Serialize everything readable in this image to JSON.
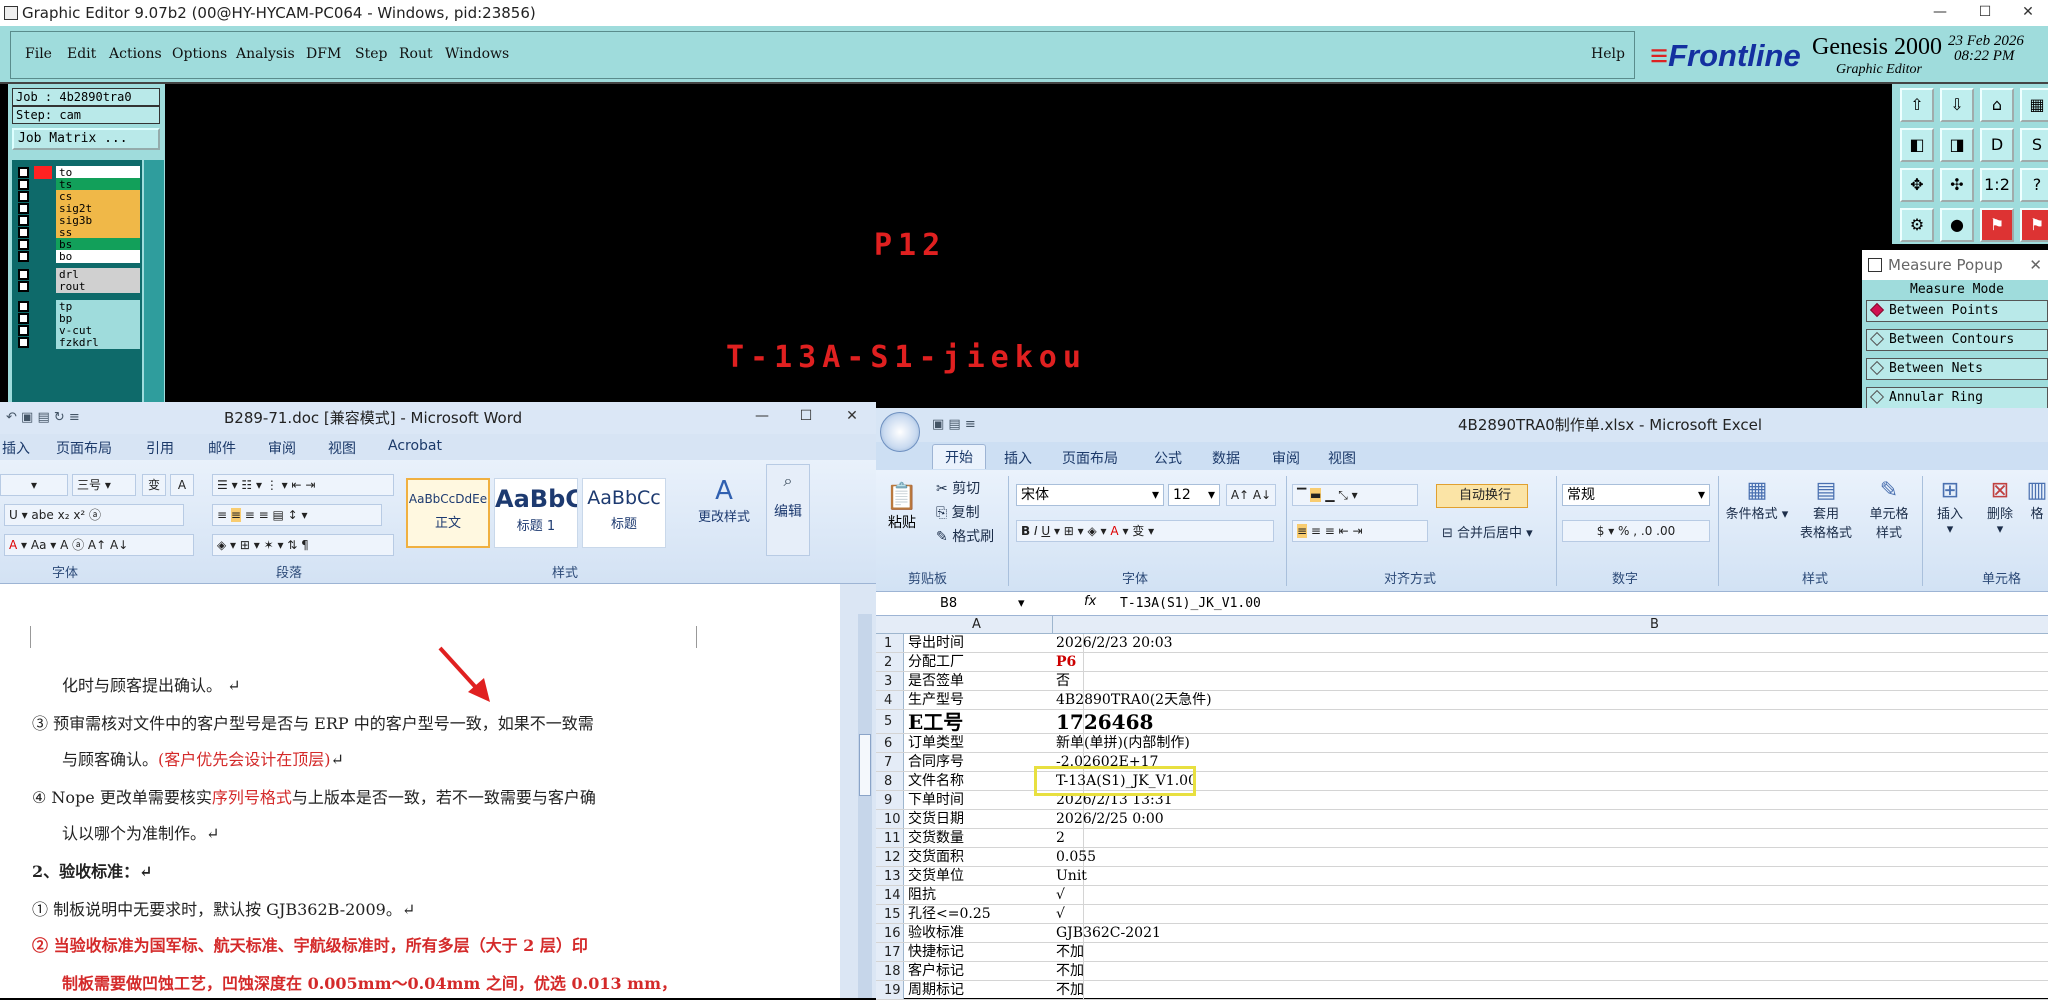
{
  "genesis": {
    "title": "Graphic Editor 9.07b2 (00@HY-HYCAM-PC064 - Windows, pid:23856)",
    "menus": [
      "File",
      "Edit",
      "Actions",
      "Options",
      "Analysis",
      "DFM",
      "Step",
      "Rout",
      "Windows"
    ],
    "help": "Help",
    "brand": "Frontline",
    "product": "Genesis 2000",
    "product_sub": "Graphic Editor",
    "date": "23 Feb 2026",
    "time": "08:22 PM",
    "job": "Job : 4b2890tra0",
    "step": "Step: cam",
    "job_matrix": "Job Matrix ...",
    "layers": [
      {
        "name": "to",
        "color": "#ffffff",
        "dot": true
      },
      {
        "name": "ts",
        "color": "#12a05a"
      },
      {
        "name": "cs",
        "color": "#f0b848"
      },
      {
        "name": "sig2t",
        "color": "#f0b848"
      },
      {
        "name": "sig3b",
        "color": "#f0b848"
      },
      {
        "name": "ss",
        "color": "#f0b848"
      },
      {
        "name": "bs",
        "color": "#12a05a"
      },
      {
        "name": "bo",
        "color": "#ffffff"
      },
      {
        "name": "drl",
        "color": "#d0d0d0"
      },
      {
        "name": "rout",
        "color": "#d0d0d0"
      },
      {
        "name": "tp",
        "color": "#9fdcdc"
      },
      {
        "name": "bp",
        "color": "#9fdcdc"
      },
      {
        "name": "v-cut",
        "color": "#9fdcdc"
      },
      {
        "name": "fzkdrl",
        "color": "#9fdcdc"
      }
    ],
    "canvas_texts": [
      "P12",
      "T-13A-S1-jiekou"
    ],
    "tool_labels": [
      "⇧",
      "⇩",
      "⌂",
      "▦",
      "◧",
      "◨",
      "D",
      "S",
      "✥",
      "✣",
      "1:2",
      "?",
      "⚙",
      "●",
      "⚑",
      "⚑"
    ],
    "measure": {
      "title": "Measure Popup",
      "mode": "Measure Mode",
      "options": [
        "Between Points",
        "Between Contours",
        "Between Nets",
        "Annular Ring"
      ],
      "selected": 0
    }
  },
  "word": {
    "title": "B289-71.doc [兼容模式] - Microsoft Word",
    "tabs": [
      "插入",
      "页面布局",
      "引用",
      "邮件",
      "审阅",
      "视图",
      "Acrobat"
    ],
    "font_size": "三号",
    "groups": [
      "字体",
      "段落",
      "样式"
    ],
    "styles": [
      {
        "sample": "AaBbCcDdEe",
        "name": "正文"
      },
      {
        "sample": "AaBbC",
        "name": "标题 1"
      },
      {
        "sample": "AaBbCc",
        "name": "标题"
      }
    ],
    "change_style": "更改样式",
    "edit": "编辑",
    "lines": [
      {
        "text": "化时与顾客提出确认。",
        "red": ""
      },
      {
        "text": "③  预审需核对文件中的客户型号是否与 ERP 中的客户型号一致，如果不一致需",
        "red": ""
      },
      {
        "text": "与顾客确认。",
        "red": "(客户优先会设计在顶层)"
      },
      {
        "text": "④  Nope 更改单需要核实",
        "red": "序列号格式",
        "tail": "与上版本是否一致，若不一致需要与客户确"
      },
      {
        "text": "认以哪个为准制作。",
        "red": ""
      },
      {
        "text": "2、验收标准：",
        "red": ""
      },
      {
        "text": "①  制板说明中无要求时，默认按 GJB362B-2009。",
        "red": ""
      },
      {
        "text": "②  当验收标准为国军标、航天标准、宇航级标准时，所有多层（大于 2 层）印",
        "red": ""
      },
      {
        "text": "制板需要做凹蚀工艺，凹蚀深度在 0.005mm～0.04mm 之间，优选 0.013 mm，",
        "red": ""
      }
    ]
  },
  "excel": {
    "title": "4B2890TRA0制作单.xlsx - Microsoft Excel",
    "tabs": [
      "开始",
      "插入",
      "页面布局",
      "公式",
      "数据",
      "审阅",
      "视图"
    ],
    "clipboard": {
      "paste": "粘贴",
      "cut": "剪切",
      "copy": "复制",
      "format_painter": "格式刷",
      "label": "剪贴板"
    },
    "font_name": "宋体",
    "font_size": "12",
    "wrap_text": "自动换行",
    "merge_center": "合并后居中",
    "number_format": "常规",
    "group_labels": [
      "字体",
      "对齐方式",
      "数字",
      "样式",
      "单元格"
    ],
    "style_buttons": [
      "条件格式",
      "套用\n表格格式",
      "单元格\n样式"
    ],
    "cell_buttons": [
      "插入",
      "删除",
      "格"
    ],
    "name_box": "B8",
    "formula": "T-13A(S1)_JK_V1.00",
    "col_a": "A",
    "col_b": "B",
    "rows": [
      {
        "n": "1",
        "a": "导出时间",
        "b": "2026/2/23 20:03"
      },
      {
        "n": "2",
        "a": "分配工厂",
        "b": "P6"
      },
      {
        "n": "3",
        "a": "是否签单",
        "b": "否"
      },
      {
        "n": "4",
        "a": "生产型号",
        "b": "4B2890TRA0(2天急件)"
      },
      {
        "n": "5",
        "a": "E工号",
        "b": "1726468"
      },
      {
        "n": "6",
        "a": "订单类型",
        "b": "新单(单拼)(内部制作)"
      },
      {
        "n": "7",
        "a": "合同序号",
        "b": "-2.02602E+17"
      },
      {
        "n": "8",
        "a": "文件名称",
        "b": "T-13A(S1)_JK_V1.00"
      },
      {
        "n": "9",
        "a": "下单时间",
        "b": "2026/2/13 13:31"
      },
      {
        "n": "10",
        "a": "交货日期",
        "b": "2026/2/25 0:00"
      },
      {
        "n": "11",
        "a": "交货数量",
        "b": "2"
      },
      {
        "n": "12",
        "a": "交货面积",
        "b": "0.055"
      },
      {
        "n": "13",
        "a": "交货单位",
        "b": "Unit"
      },
      {
        "n": "14",
        "a": "阻抗",
        "b": "√"
      },
      {
        "n": "15",
        "a": "孔径<=0.25",
        "b": "√"
      },
      {
        "n": "16",
        "a": "验收标准",
        "b": "GJB362C-2021"
      },
      {
        "n": "17",
        "a": "快捷标记",
        "b": "不加"
      },
      {
        "n": "18",
        "a": "客户标记",
        "b": "不加"
      },
      {
        "n": "19",
        "a": "周期标记",
        "b": "不加"
      }
    ]
  },
  "colors": {
    "genesis_panel": "#9fdcdc",
    "canvas_text": "#e02020",
    "highlight": "#e8e040",
    "p6": "#cc0000"
  }
}
